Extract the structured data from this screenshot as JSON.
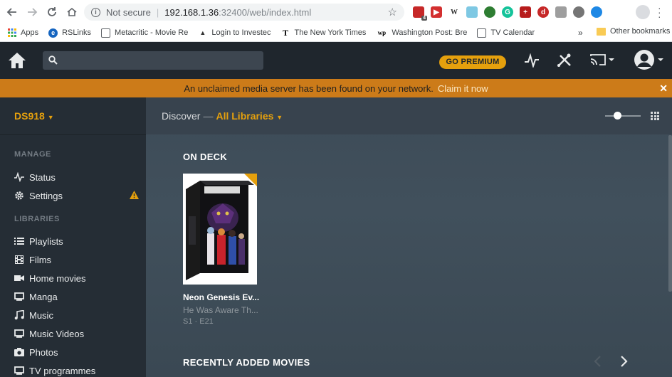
{
  "browser": {
    "security_label": "Not secure",
    "url_host": "192.168.1.36",
    "url_path": ":32400/web/index.html",
    "extension_badge": "4",
    "bookmarks": [
      {
        "label": "Apps"
      },
      {
        "label": "RSLinks"
      },
      {
        "label": "Metacritic - Movie Re"
      },
      {
        "label": "Login to Investec"
      },
      {
        "label": "The New York Times"
      },
      {
        "label": "Washington Post: Bre"
      },
      {
        "label": "TV Calendar"
      }
    ],
    "bookmarks_more": "»",
    "other_bookmarks": "Other bookmarks"
  },
  "header": {
    "premium_label": "GO PREMIUM"
  },
  "banner": {
    "message": "An unclaimed media server has been found on your network.",
    "action": "Claim it now"
  },
  "sidebar": {
    "server_name": "DS918",
    "manage_heading": "MANAGE",
    "manage_items": [
      {
        "label": "Status",
        "icon": "activity-icon"
      },
      {
        "label": "Settings",
        "icon": "gear-icon"
      }
    ],
    "libraries_heading": "LIBRARIES",
    "library_items": [
      {
        "label": "Playlists",
        "icon": "list-icon"
      },
      {
        "label": "Films",
        "icon": "film-icon"
      },
      {
        "label": "Home movies",
        "icon": "video-camera-icon"
      },
      {
        "label": "Manga",
        "icon": "monitor-icon"
      },
      {
        "label": "Music",
        "icon": "music-note-icon"
      },
      {
        "label": "Music Videos",
        "icon": "monitor-icon"
      },
      {
        "label": "Photos",
        "icon": "camera-icon"
      },
      {
        "label": "TV programmes",
        "icon": "monitor-icon"
      }
    ]
  },
  "main": {
    "discover_label": "Discover",
    "separator": "—",
    "library_filter": "All Libraries",
    "on_deck_heading": "ON DECK",
    "on_deck_item": {
      "title": "Neon Genesis Ev...",
      "subtitle": "He Was Aware Th...",
      "episode": "S1 · E21"
    },
    "recently_added_heading": "RECENTLY ADDED MOVIES"
  },
  "colors": {
    "accent": "#e5a00d",
    "banner": "#cc7b19",
    "header_bg": "#1f262d",
    "sidebar_bg": "#252d35"
  }
}
